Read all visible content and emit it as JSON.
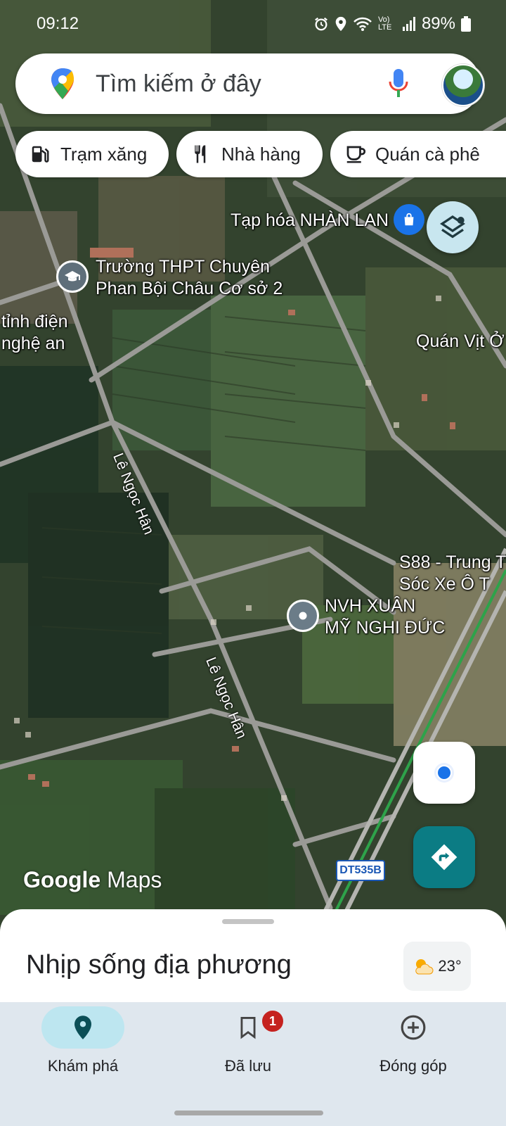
{
  "status_bar": {
    "time": "09:12",
    "network": "Vo) LTE",
    "battery": "89%"
  },
  "search": {
    "placeholder": "Tìm kiếm ở đây"
  },
  "chips": [
    {
      "label": "Trạm xăng",
      "icon": "gas-station-icon"
    },
    {
      "label": "Nhà hàng",
      "icon": "restaurant-icon"
    },
    {
      "label": "Quán cà phê",
      "icon": "coffee-icon"
    }
  ],
  "map": {
    "labels": {
      "taphoa": "Tạp hóa NHÀN LAN",
      "school_line1": "Trường THPT Chuyên",
      "school_line2": "Phan Bội Châu Cơ sở 2",
      "tinh_dien_line1": "tỉnh điện",
      "tinh_dien_line2": "nghệ an",
      "quan_vit": "Quán Vịt Ở",
      "s88_line1": "S88 - Trung T",
      "s88_line2": "Sóc Xe Ô T",
      "nvh_line1": "NVH XUÂN",
      "nvh_line2": "MỸ NGHI ĐỨC",
      "road1": "Lê Ngọc Hân",
      "road2": "Lê Ngọc Hân",
      "shield": "DT535B"
    },
    "attribution_google": "Google",
    "attribution_maps": "Maps"
  },
  "sheet": {
    "title": "Nhịp sống địa phương",
    "temperature": "23°"
  },
  "bottom_nav": [
    {
      "label": "Khám phá",
      "icon": "explore-pin-icon",
      "active": true
    },
    {
      "label": "Đã lưu",
      "icon": "saved-bookmark-icon",
      "badge": "1"
    },
    {
      "label": "Đóng góp",
      "icon": "contribute-plus-icon"
    }
  ],
  "colors": {
    "accent_teal": "#0b7c84",
    "active_nav": "#bde6f0",
    "badge_red": "#c5221f"
  }
}
